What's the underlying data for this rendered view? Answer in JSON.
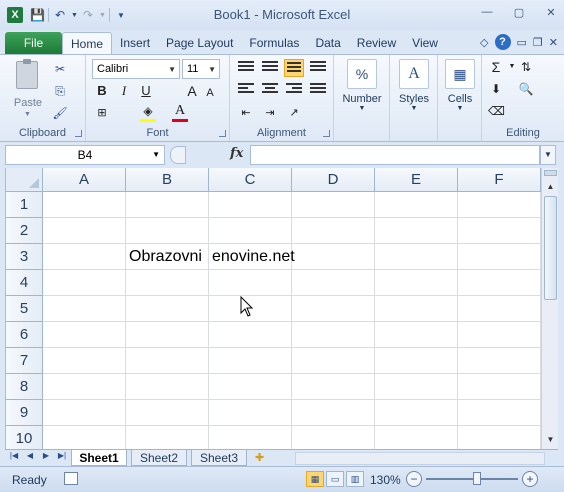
{
  "window": {
    "title": "Book1  -  Microsoft Excel",
    "app_logo": "X"
  },
  "quick_access": {
    "icons": [
      "save-icon",
      "undo-icon",
      "redo-icon",
      "customize-icon"
    ]
  },
  "ribbon_tabs": [
    {
      "label": "File"
    },
    {
      "label": "Home",
      "active": true
    },
    {
      "label": "Insert"
    },
    {
      "label": "Page Layout"
    },
    {
      "label": "Formulas"
    },
    {
      "label": "Data"
    },
    {
      "label": "Review"
    },
    {
      "label": "View"
    }
  ],
  "ribbon": {
    "clipboard": {
      "label": "Clipboard",
      "paste_label": "Paste"
    },
    "font": {
      "label": "Font",
      "font_name": "Calibri",
      "font_size": "11",
      "bold": "B",
      "italic": "I",
      "underline": "U",
      "grow": "A",
      "shrink": "A",
      "font_color": "A"
    },
    "alignment": {
      "label": "Alignment"
    },
    "number": {
      "label": "Number",
      "icon_text": "%"
    },
    "styles": {
      "label": "Styles",
      "icon_text": "A"
    },
    "cells": {
      "label": "Cells",
      "icon_text": "▦"
    },
    "editing": {
      "label": "Editing",
      "sum": "Σ"
    }
  },
  "formula_bar": {
    "name_box": "B4",
    "fx": "fx",
    "formula": ""
  },
  "grid": {
    "columns": [
      "A",
      "B",
      "C",
      "D",
      "E",
      "F"
    ],
    "rows": [
      "1",
      "2",
      "3",
      "4",
      "5",
      "6",
      "7",
      "8",
      "9",
      "10"
    ],
    "cells": [
      {
        "ref": "B3",
        "value": "Obrazovni"
      },
      {
        "ref": "C3",
        "value": "enovine.net"
      }
    ]
  },
  "sheets": [
    {
      "label": "Sheet1",
      "active": true
    },
    {
      "label": "Sheet2"
    },
    {
      "label": "Sheet3"
    }
  ],
  "status": {
    "text": "Ready",
    "zoom": "130%",
    "zoom_percent": 130
  },
  "colors": {
    "file_tab": "#1d7a37",
    "accent": "#ffd66e",
    "font_color_bar": "#e0001b",
    "fill_color_bar": "#ffff00"
  }
}
